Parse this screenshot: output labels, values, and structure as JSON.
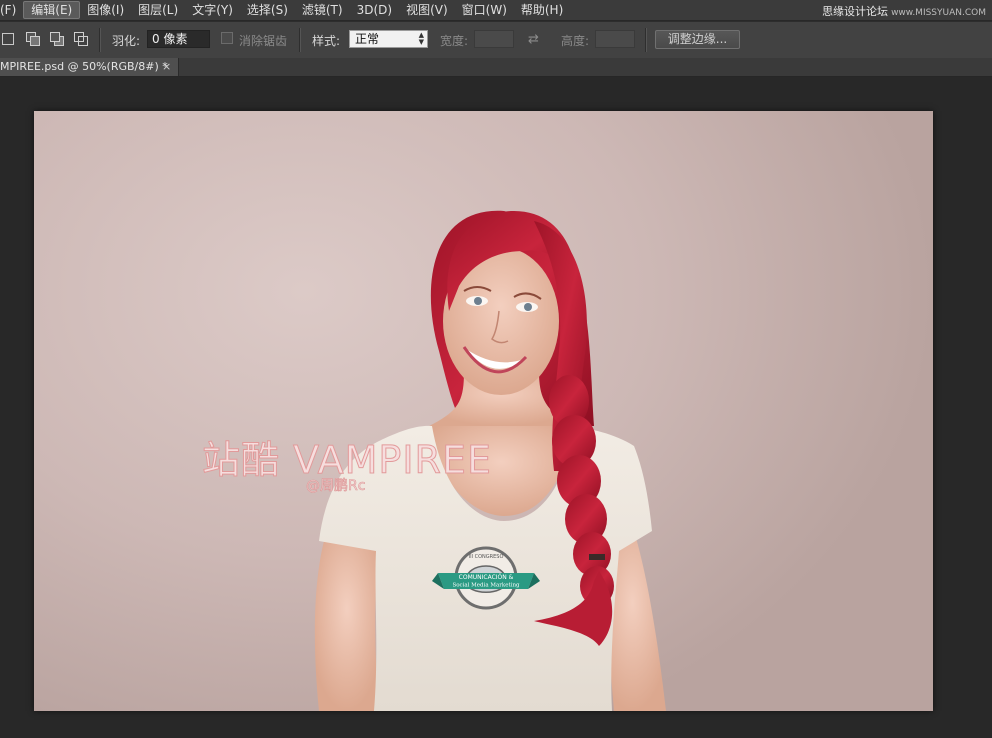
{
  "menubar": {
    "items": [
      "(F)",
      "编辑(E)",
      "图像(I)",
      "图层(L)",
      "文字(Y)",
      "选择(S)",
      "滤镜(T)",
      "3D(D)",
      "视图(V)",
      "窗口(W)",
      "帮助(H)"
    ],
    "active_index": 1
  },
  "watermark": {
    "text": "思缘设计论坛",
    "url": "www.MISSYUAN.COM"
  },
  "options": {
    "feather_label": "羽化:",
    "feather_value": "0 像素",
    "antialias_label": "消除锯齿",
    "style_label": "样式:",
    "style_value": "正常",
    "width_label": "宽度:",
    "height_label": "高度:",
    "refine_edge_label": "调整边缘..."
  },
  "document": {
    "tab_title": "MPIREE.psd @ 50%(RGB/8#) *",
    "close_glyph": "×"
  },
  "canvas_content": {
    "headline": "站酷 VAMPIREE",
    "byline": "@周鹏Rc",
    "shirt_badge": {
      "line1": "III CONGRESO",
      "line2": "COMUNICACIÓN &",
      "line3": "Social Media Marketing"
    }
  },
  "colors": {
    "menubar_bg": "#3b3b3b",
    "options_bg": "#424242",
    "workspace_bg": "#282828",
    "hair": "#b51c32",
    "badge": "#2a9a83"
  }
}
